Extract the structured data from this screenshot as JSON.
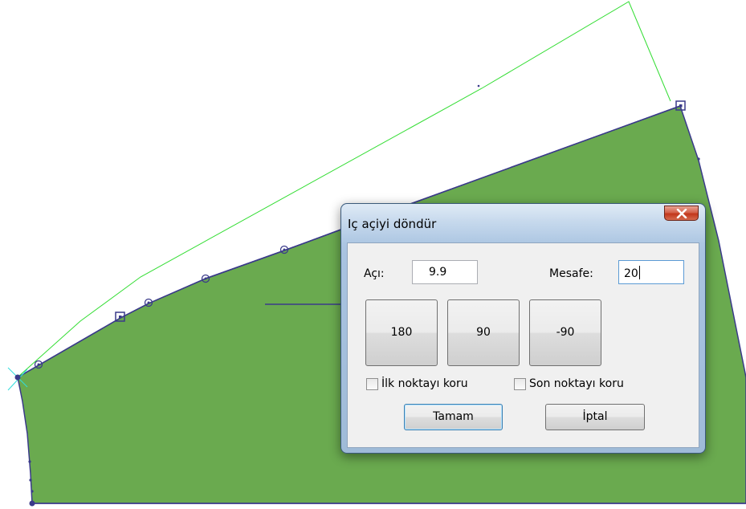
{
  "dialog": {
    "title": "Iç açiyi döndür",
    "close_icon": "close-x-icon",
    "angle_label": "Açı:",
    "angle_value": "9.9",
    "distance_label": "Mesafe:",
    "distance_value": "20",
    "buttons": {
      "b180": "180",
      "b90": "90",
      "bm90": "-90"
    },
    "keep_first_label": "İlk noktayı koru",
    "keep_last_label": "Son noktayı koru",
    "keep_first_checked": false,
    "keep_last_checked": false,
    "ok_label": "Tamam",
    "cancel_label": "İptal"
  },
  "canvas": {
    "fill_color": "#6aaa4f",
    "outline_color": "#3a3a8a",
    "guide_color": "#33cc33"
  }
}
